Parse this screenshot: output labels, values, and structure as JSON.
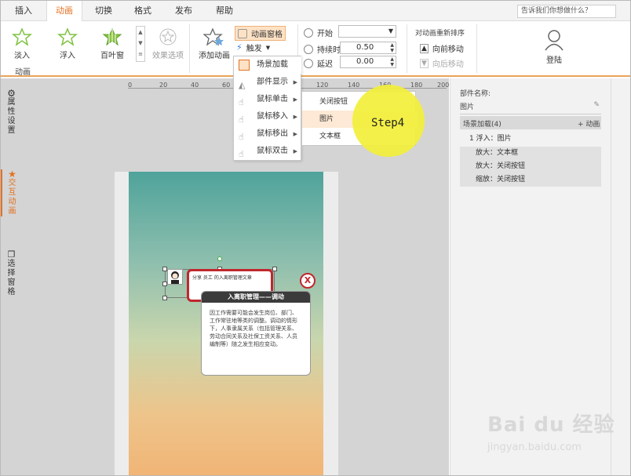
{
  "tabs": [
    "插入",
    "动画",
    "切换",
    "格式",
    "发布",
    "帮助"
  ],
  "active_tab": "动画",
  "help_search": "告诉我们你想做什么？",
  "ribbon": {
    "effects": [
      "淡入",
      "浮入",
      "百叶窗"
    ],
    "effect_options": "效果选项",
    "group_label": "动画",
    "add_animation": "添加动画",
    "animation_pane": "动画窗格",
    "trigger": "触发",
    "start_label": "开始",
    "duration_label": "持续时间",
    "duration_value": "0.50",
    "delay_label": "延迟",
    "delay_value": "0.00",
    "reorder_label": "对动画重新排序",
    "move_earlier": "向前移动",
    "move_later": "向后移动",
    "login": "登陆"
  },
  "trigger_menu": [
    "场景加载",
    "部件显示",
    "鼠标单击",
    "鼠标移入",
    "鼠标移出",
    "鼠标双击"
  ],
  "submenu": [
    "关闭按钮",
    "图片",
    "文本框"
  ],
  "step_label": "Step4",
  "ruler_ticks": [
    "0",
    "20",
    "40",
    "60",
    "80",
    "100",
    "120",
    "140",
    "160",
    "180",
    "200"
  ],
  "slide": {
    "share_line": "分享 员工 的入离职管理文章",
    "popup_title": "入离职管理——调动",
    "popup_body": "因工作需要可能会发生岗位、部门、工作常驻地等类的调整。调动的情形下，人事隶属关系（包括管理关系、劳动合同关系及社保工资关系、人员编制等）随之发生相应变动。",
    "close_icon_text": "X"
  },
  "right_panel": {
    "component_label": "部件名称:",
    "component_value": "图片",
    "scene_header": "场景加载(4)",
    "add_animation": "+ 动画",
    "rows": [
      "1  浮入：图片",
      "放大：文本框",
      "放大：关闭按钮",
      "缩放：关闭按钮"
    ]
  },
  "side_tools": [
    "属性设置",
    "交互动画",
    "选择窗格"
  ],
  "watermark": {
    "main": "Bai du 经验",
    "url": "jingyan.baidu.com"
  },
  "colors": {
    "accent": "#e37222",
    "highlight": "#f2ef3a",
    "popup_header": "#3b3b3b",
    "red": "#c0272d"
  }
}
